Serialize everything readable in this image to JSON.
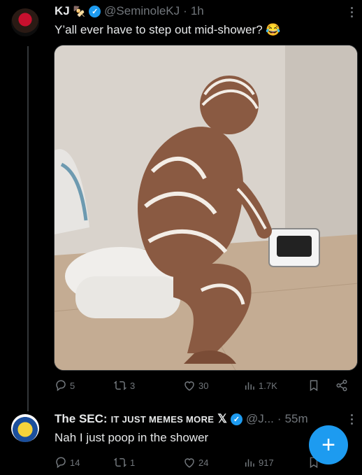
{
  "tweet": {
    "author_name": "KJ",
    "author_emoji": "🍢",
    "handle": "@SeminoleKJ",
    "separator": "·",
    "time": "1h",
    "text": "Y’all ever have to step out mid-shower? 😂",
    "stats": {
      "replies": "5",
      "retweets": "3",
      "likes": "30",
      "views": "1.7K"
    }
  },
  "reply": {
    "author_name": "The SEC:",
    "author_tagline": "IT JUST MEMES MORE",
    "x_badge": "𝕏",
    "handle": "@J...",
    "separator": "·",
    "time": "55m",
    "text": "Nah I just poop in the shower",
    "stats": {
      "replies": "14",
      "retweets": "1",
      "likes": "24",
      "views": "917"
    }
  },
  "fab": {
    "label": "+"
  },
  "colors": {
    "background": "#000000",
    "text": "#e7e9ea",
    "muted": "#71767b",
    "accent": "#1d9bf0",
    "border": "#2f3336"
  }
}
